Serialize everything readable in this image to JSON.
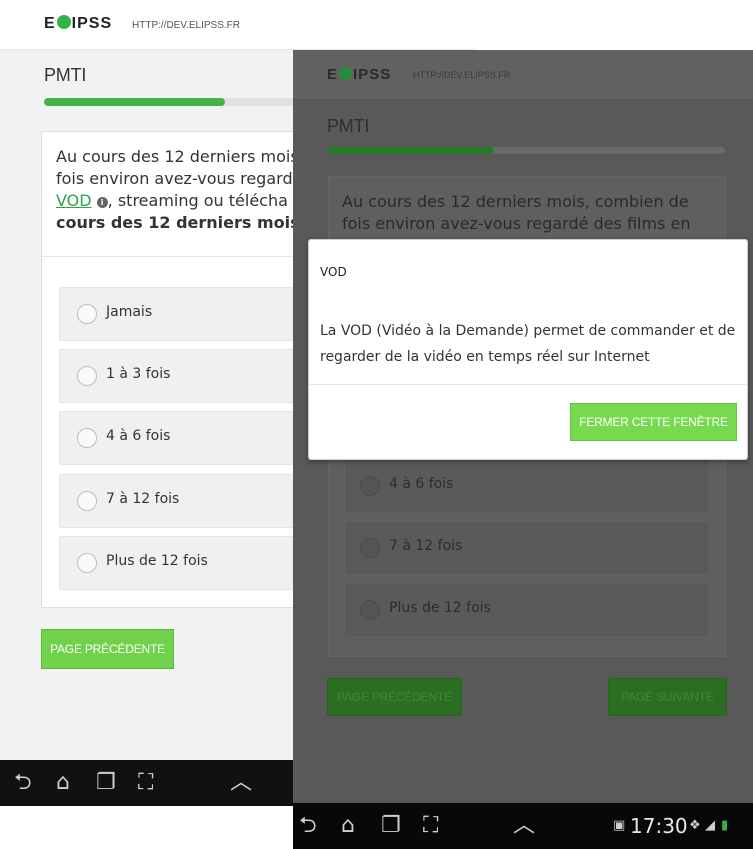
{
  "brand": {
    "logo_text_before": "E",
    "logo_text_after": "IPSS",
    "url": "HTTP://DEV.ELIPSS.FR"
  },
  "page": {
    "title": "PMTI",
    "progress": 0.42
  },
  "screen_left": {
    "question": {
      "part1": "Au cours des 12 derniers mois",
      "part2": "fois environ avez-vous regard",
      "link": "VOD",
      "info": "i",
      "part3": ", streaming ou télécha",
      "part4": "cours des 12 derniers mois"
    },
    "options": [
      "Jamais",
      "1 à 3 fois",
      "4 à 6 fois",
      "7 à 12 fois",
      "Plus de 12 fois"
    ],
    "prev_button": "PAGE PRÉCÉDENTE"
  },
  "screen_right": {
    "question": {
      "line1": "Au cours des 12 derniers mois, combien de",
      "line2": "fois environ avez-vous regardé des films en"
    },
    "options": [
      "4 à 6 fois",
      "7 à 12 fois",
      "Plus de 12 fois"
    ],
    "prev_button": "PAGE PRÉCÉDENTE",
    "next_button": "PAGE SUIVANTE"
  },
  "modal": {
    "title": "VOD",
    "body": "La VOD (Vidéo à la Demande) permet de commander et de regarder de la vidéo en temps réel sur Internet",
    "close_button": "FERMER CETTE FENÊTRE"
  },
  "status_bar": {
    "time": "17:30"
  },
  "colors": {
    "accent": "#43b544",
    "button": "#77d94e",
    "link": "#2fa34a"
  },
  "icons": [
    "back-icon",
    "home-icon",
    "recent-apps-icon",
    "screenshot-icon",
    "up-chevron-icon",
    "gallery-icon",
    "wifi-icon",
    "signal-icon",
    "battery-icon"
  ]
}
